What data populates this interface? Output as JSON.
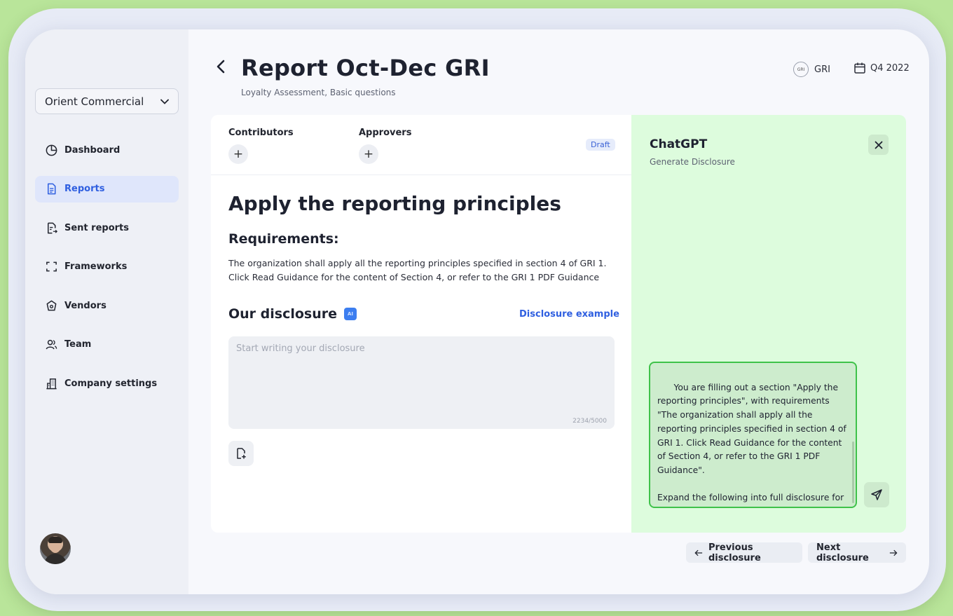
{
  "sidebar": {
    "org_name": "Orient Commercial",
    "items": [
      {
        "label": "Dashboard",
        "icon": "pie-chart-icon",
        "active": false
      },
      {
        "label": "Reports",
        "icon": "document-icon",
        "active": true
      },
      {
        "label": "Sent reports",
        "icon": "sent-document-icon",
        "active": false
      },
      {
        "label": "Frameworks",
        "icon": "frame-icon",
        "active": false
      },
      {
        "label": "Vendors",
        "icon": "hexagon-icon",
        "active": false
      },
      {
        "label": "Team",
        "icon": "team-icon",
        "active": false
      },
      {
        "label": "Company settings",
        "icon": "building-icon",
        "active": false
      }
    ]
  },
  "header": {
    "title": "Report Oct-Dec GRI",
    "subtitle": "Loyalty Assessment, Basic questions",
    "framework": "GRI",
    "period": "Q4 2022"
  },
  "card": {
    "contributors_label": "Contributors",
    "approvers_label": "Approvers",
    "status": "Draft",
    "section_title": "Apply the reporting principles",
    "requirements_title": "Requirements:",
    "requirements_text": "The organization shall apply all the reporting principles specified in section 4 of GRI 1. Click Read Guidance for the content of Section 4, or refer to the GRI 1 PDF Guidance",
    "disclosure_title": "Our disclosure",
    "ai_badge": "AI",
    "disclosure_example": "Disclosure example",
    "disclosure_placeholder": "Start writing your disclosure",
    "char_counter": "2234/5000"
  },
  "chat": {
    "title": "ChatGPT",
    "subtitle": "Generate Disclosure",
    "prompt": "You are filling out a section \"Apply the reporting principles\", with requirements \"The organization shall apply all the reporting principles specified in section 4 of GRI 1. Click Read Guidance for the content of Section 4, or refer to the GRI 1 PDF Guidance\".\n\nExpand the following into full disclosure for this section: \"\""
  },
  "footer": {
    "prev_label": "Previous disclosure",
    "next_label": "Next disclosure"
  },
  "colors": {
    "background": "#b9e59a",
    "accent": "#2f5fe0",
    "chat_panel": "#ddfcdd",
    "chat_border": "#3fc24a"
  }
}
